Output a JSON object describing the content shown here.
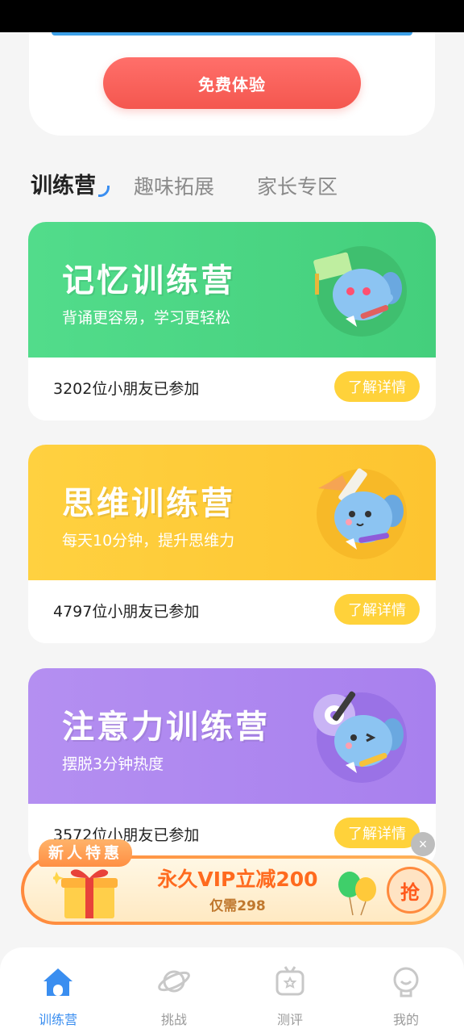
{
  "top_card": {
    "trial_button": "免费体验"
  },
  "tabs": [
    {
      "label": "训练营",
      "active": true
    },
    {
      "label": "趣味拓展",
      "active": false
    },
    {
      "label": "家长专区",
      "active": false
    }
  ],
  "camps": [
    {
      "title": "记忆训练营",
      "subtitle": "背诵更容易，学习更轻松",
      "participants": "3202位小朋友已参加",
      "button": "了解详情",
      "color": "#4fd786"
    },
    {
      "title": "思维训练营",
      "subtitle": "每天10分钟，提升思维力",
      "participants": "4797位小朋友已参加",
      "button": "了解详情",
      "color": "#ffcb38"
    },
    {
      "title": "注意力训练营",
      "subtitle": "摆脱3分钟热度",
      "participants": "3572位小朋友已参加",
      "button": "了解详情",
      "color": "#ae88ef"
    }
  ],
  "promo": {
    "tag": "新人特惠",
    "main": "永久VIP立减200",
    "sub": "仅需298",
    "grab": "抢",
    "close": "×"
  },
  "bottom_nav": [
    {
      "label": "训练营",
      "icon": "home-icon",
      "active": true
    },
    {
      "label": "挑战",
      "icon": "planet-icon",
      "active": false
    },
    {
      "label": "测评",
      "icon": "evaluation-icon",
      "active": false
    },
    {
      "label": "我的",
      "icon": "profile-icon",
      "active": false
    }
  ],
  "colors": {
    "accent": "#3a8ef0",
    "button_red": "#f4574f",
    "detail_yellow": "#ffd23a",
    "promo_orange": "#ff8a3d"
  }
}
